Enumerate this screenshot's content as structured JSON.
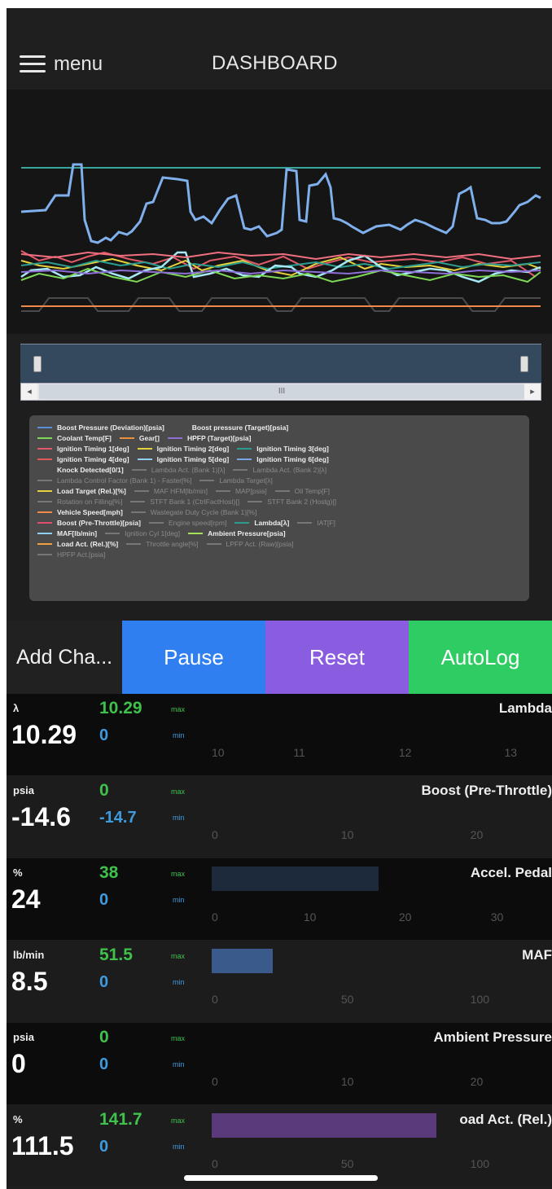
{
  "header": {
    "menu_label": "menu",
    "title": "DASHBOARD",
    "menu_icon": "hamburger-icon"
  },
  "chart": {
    "type": "line",
    "scroll_label": "III"
  },
  "legend": [
    [
      {
        "name": "Boost Pressure (Deviation)[psia]",
        "color": "#5b8fd6",
        "on": true
      },
      {
        "name": "Boost pressure (Target)[psia]",
        "color": "#4a4a4a",
        "on": true
      }
    ],
    [
      {
        "name": "Coolant Temp[F]",
        "color": "#7ed957",
        "on": true
      },
      {
        "name": "Gear[]",
        "color": "#e8913a",
        "on": true
      },
      {
        "name": "HPFP (Target)[psia]",
        "color": "#8e6fd8",
        "on": true
      }
    ],
    [
      {
        "name": "Ignition Timing 1[deg]",
        "color": "#e05a6a",
        "on": true
      },
      {
        "name": "Ignition Timing 2[deg]",
        "color": "#e6d23c",
        "on": true
      },
      {
        "name": "Ignition Timing 3[deg]",
        "color": "#2a9d8f",
        "on": true
      }
    ],
    [
      {
        "name": "Ignition Timing 4[deg]",
        "color": "#e05a5a",
        "on": true
      },
      {
        "name": "Ignition Timing 5[deg]",
        "color": "#8fd0f0",
        "on": true
      },
      {
        "name": "Ignition Timing 6[deg]",
        "color": "#7aa6e8",
        "on": true
      }
    ],
    [
      {
        "name": "Knock Detected[0/1]",
        "color": "#4a4a4a",
        "on": true
      },
      {
        "name": "Lambda Act. (Bank 1)[λ]",
        "color": "#777",
        "on": false
      },
      {
        "name": "Lambda Act. (Bank 2)[λ]",
        "color": "#777",
        "on": false
      }
    ],
    [
      {
        "name": "Lambda Control Factor (Bank 1) - Faster[%]",
        "color": "#777",
        "on": false
      },
      {
        "name": "Lambda Target[λ]",
        "color": "#777",
        "on": false
      }
    ],
    [
      {
        "name": "Load Target (Rel.)[%]",
        "color": "#e6d23c",
        "on": true
      },
      {
        "name": "MAF HFM[lb/min]",
        "color": "#777",
        "on": false
      },
      {
        "name": "MAP[psia]",
        "color": "#777",
        "on": false
      },
      {
        "name": "Oil Temp[F]",
        "color": "#777",
        "on": false
      }
    ],
    [
      {
        "name": "Rotation on Filling[%]",
        "color": "#777",
        "on": false
      },
      {
        "name": "STFT Bank 1 (CtrlFactHost)[]",
        "color": "#777",
        "on": false
      },
      {
        "name": "STFT Bank 2 (Hostg)[]",
        "color": "#777",
        "on": false
      }
    ],
    [
      {
        "name": "Vehicle Speed[mph]",
        "color": "#f08a4b",
        "on": true
      },
      {
        "name": "Wastegate Duty Cycle (Bank 1)[%]",
        "color": "#777",
        "on": false
      }
    ],
    [
      {
        "name": "Boost (Pre-Throttle)[psia]",
        "color": "#e0506a",
        "on": true
      },
      {
        "name": "Engine speed[rpm]",
        "color": "#777",
        "on": false
      },
      {
        "name": "Lambda[λ]",
        "color": "#2a9d8f",
        "on": true
      },
      {
        "name": "IAT[F]",
        "color": "#777",
        "on": false
      }
    ],
    [
      {
        "name": "MAF[lb/min]",
        "color": "#8fd0f0",
        "on": true
      },
      {
        "name": "Ignition Cyl 1[deg]",
        "color": "#777",
        "on": false
      },
      {
        "name": "Ambient Pressure[psia]",
        "color": "#a6e05a",
        "on": true
      }
    ],
    [
      {
        "name": "Load Act. (Rel.)[%]",
        "color": "#f0a040",
        "on": true
      },
      {
        "name": "Throttle angle[%]",
        "color": "#777",
        "on": false
      },
      {
        "name": "LPFP Act. (Raw)[psia]",
        "color": "#777",
        "on": false
      }
    ],
    [
      {
        "name": "HPFP Act.[psia]",
        "color": "#777",
        "on": false
      }
    ]
  ],
  "buttons": {
    "add": "Add Cha...",
    "pause": "Pause",
    "reset": "Reset",
    "autolog": "AutoLog"
  },
  "gauge_labels": {
    "max": "max",
    "min": "min"
  },
  "gauges": [
    {
      "unit": "λ",
      "value": "10.29",
      "max": "10.29",
      "min": "0",
      "name": "Lambda",
      "ticks": [
        "10",
        "11",
        "12",
        "13"
      ],
      "tick_pos": [
        0,
        0.24,
        0.55,
        0.86
      ],
      "fill": 0,
      "bar_color": "#2a3a55"
    },
    {
      "unit": "psia",
      "value": "-14.6",
      "max": "0",
      "min": "-14.7",
      "name": "Boost (Pre-Throttle)",
      "ticks": [
        "0",
        "10",
        "20"
      ],
      "tick_pos": [
        0,
        0.38,
        0.76
      ],
      "fill": 0,
      "bar_color": "#2a3a55"
    },
    {
      "unit": "%",
      "value": "24",
      "max": "38",
      "min": "0",
      "name": "Accel. Pedal",
      "ticks": [
        "0",
        "10",
        "20",
        "30"
      ],
      "tick_pos": [
        0,
        0.27,
        0.55,
        0.82
      ],
      "fill": 0.49,
      "bar_color": "#1c2a3c"
    },
    {
      "unit": "lb/min",
      "value": "8.5",
      "max": "51.5",
      "min": "0",
      "name": "MAF",
      "ticks": [
        "0",
        "50",
        "100"
      ],
      "tick_pos": [
        0,
        0.38,
        0.76
      ],
      "fill": 0.18,
      "bar_color": "#3a5a8c"
    },
    {
      "unit": "psia",
      "value": "0",
      "max": "0",
      "min": "0",
      "name": "Ambient Pressure",
      "ticks": [
        "0",
        "10",
        "20"
      ],
      "tick_pos": [
        0,
        0.38,
        0.76
      ],
      "fill": 0,
      "bar_color": "#2a3a55"
    },
    {
      "unit": "%",
      "value": "111.5",
      "max": "141.7",
      "min": "0",
      "name": "oad Act. (Rel.)",
      "ticks": [
        "0",
        "50",
        "100"
      ],
      "tick_pos": [
        0,
        0.38,
        0.76
      ],
      "fill": 0.66,
      "bar_color": "#5a3a7a"
    }
  ]
}
